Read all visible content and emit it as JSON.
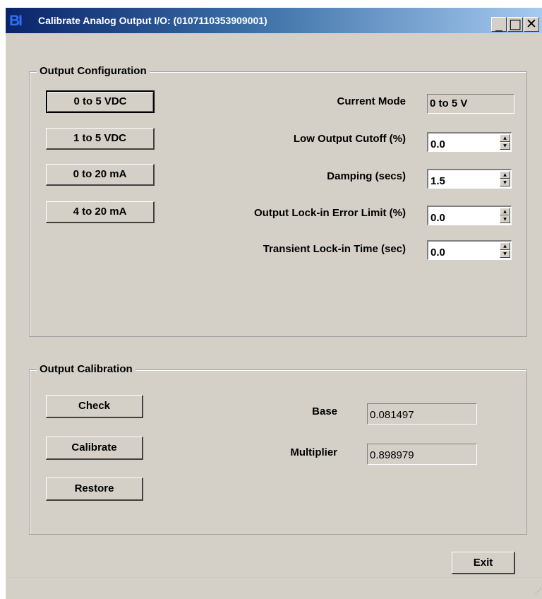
{
  "window": {
    "title": "Calibrate Analog Output I/O: (0107110353909001)",
    "app_icon_text": "BI",
    "controls": {
      "minimize": "_",
      "maximize": "□",
      "close": "✕"
    }
  },
  "output_configuration": {
    "title": "Output Configuration",
    "mode_buttons": [
      "0 to 5 VDC",
      "1 to 5 VDC",
      "0 to 20 mA",
      "4 to 20 mA"
    ],
    "current_mode_label": "Current Mode",
    "current_mode_value": "0 to 5 V",
    "low_output_cutoff_label": "Low Output Cutoff (%)",
    "low_output_cutoff_value": "0.0",
    "damping_label": "Damping (secs)",
    "damping_value": "1.5",
    "lockin_error_label": "Output Lock-in Error Limit (%)",
    "lockin_error_value": "0.0",
    "transient_lockin_label": "Transient Lock-in Time (sec)",
    "transient_lockin_value": "0.0"
  },
  "output_calibration": {
    "title": "Output Calibration",
    "check_label": "Check",
    "calibrate_label": "Calibrate",
    "restore_label": "Restore",
    "base_label": "Base",
    "base_value": "0.081497",
    "multiplier_label": "Multiplier",
    "multiplier_value": "0.898979"
  },
  "footer": {
    "exit_label": "Exit"
  }
}
